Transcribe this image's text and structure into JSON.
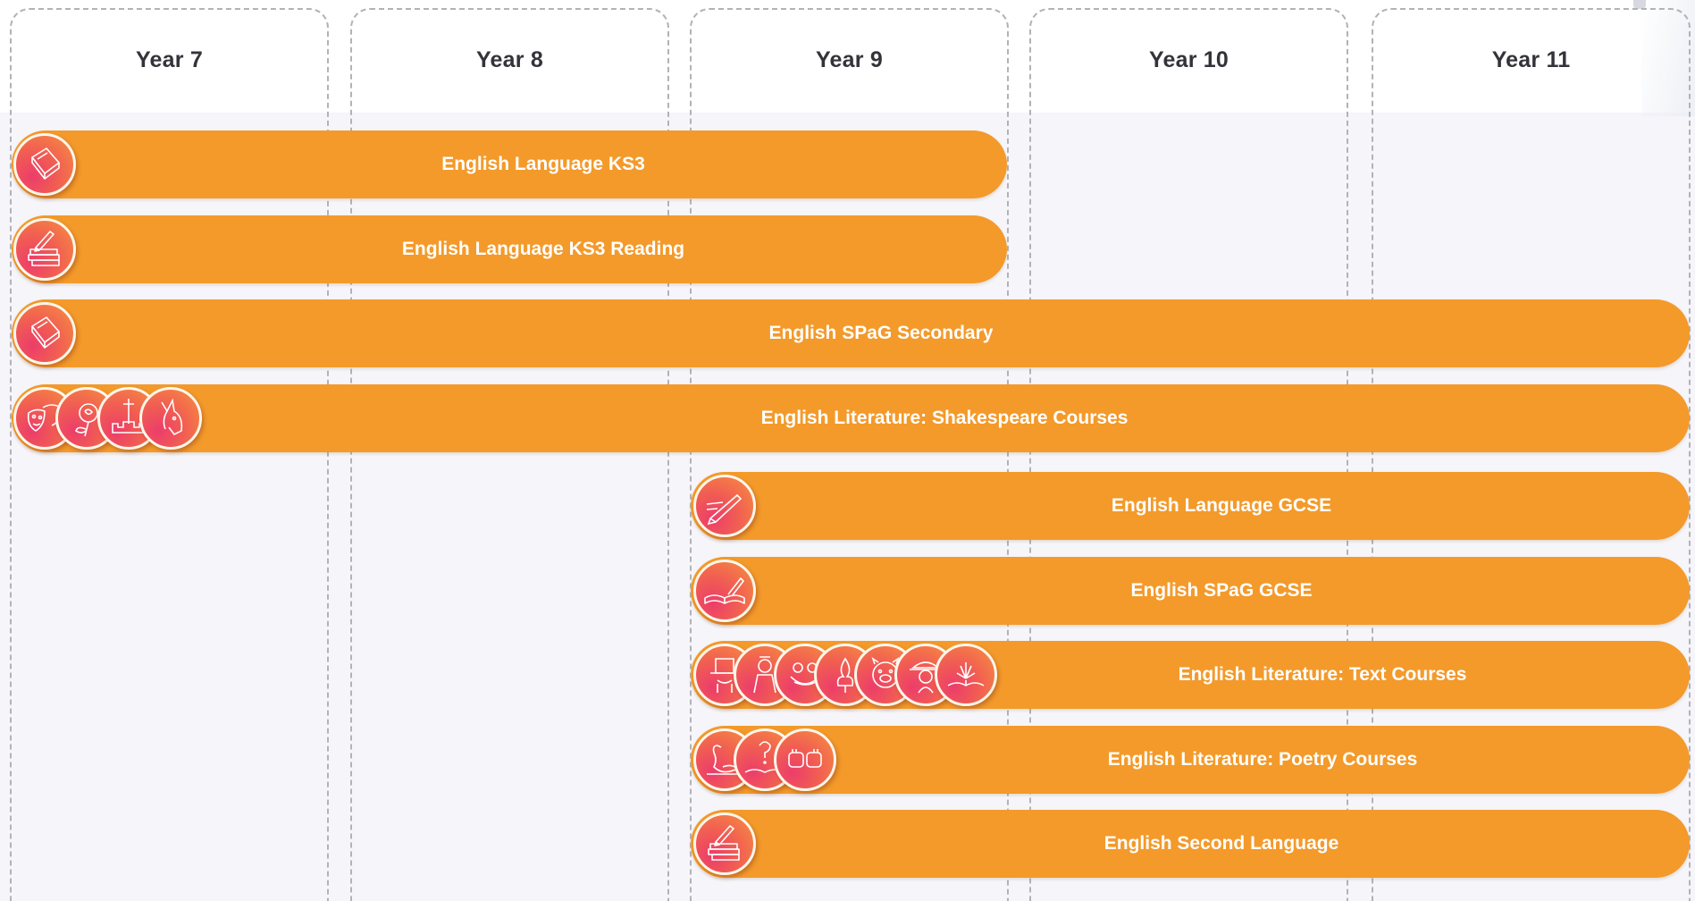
{
  "columns": [
    {
      "label": "Year 7"
    },
    {
      "label": "Year 8"
    },
    {
      "label": "Year 9"
    },
    {
      "label": "Year 10"
    },
    {
      "label": "Year 11"
    }
  ],
  "courses": [
    {
      "label": "English Language KS3",
      "start_year": "Year 7",
      "end_year": "Year 9",
      "icons": [
        "book-icon"
      ]
    },
    {
      "label": "English Language KS3 Reading",
      "start_year": "Year 7",
      "end_year": "Year 9",
      "icons": [
        "books-pencil-icon"
      ]
    },
    {
      "label": "English SPaG Secondary",
      "start_year": "Year 7",
      "end_year": "Year 11",
      "icons": [
        "book-icon"
      ]
    },
    {
      "label": "English Literature: Shakespeare Courses",
      "start_year": "Year 7",
      "end_year": "Year 11",
      "icons": [
        "theatre-masks-icon",
        "rose-icon",
        "castle-dagger-icon",
        "donkey-icon"
      ]
    },
    {
      "label": "English Language GCSE",
      "start_year": "Year 9",
      "end_year": "Year 11",
      "icons": [
        "quill-pen-icon"
      ]
    },
    {
      "label": "English SPaG GCSE",
      "start_year": "Year 9",
      "end_year": "Year 11",
      "icons": [
        "open-book-pen-icon"
      ]
    },
    {
      "label": "English Literature: Text Courses",
      "start_year": "Year 9",
      "end_year": "Year 11",
      "icons": [
        "top-hat-icon",
        "victorian-figure-icon",
        "frog-icon",
        "flame-tree-icon",
        "pig-icon",
        "detective-icon",
        "magic-book-icon"
      ]
    },
    {
      "label": "English Literature: Poetry Courses",
      "start_year": "Year 9",
      "end_year": "Year 11",
      "icons": [
        "swan-icon",
        "question-book-icon",
        "fists-icon"
      ]
    },
    {
      "label": "English Second Language",
      "start_year": "Year 9",
      "end_year": "Year 11",
      "icons": [
        "books-pencil-icon"
      ]
    }
  ],
  "colors": {
    "bar": "#f39a2b",
    "bar_text": "#ffffff",
    "icon_gradient_start": "#ec3d6a",
    "icon_gradient_end": "#f6913f",
    "header_text": "#33333a",
    "column_border": "#b2b2b8",
    "track_background": "#f5f5fa"
  }
}
